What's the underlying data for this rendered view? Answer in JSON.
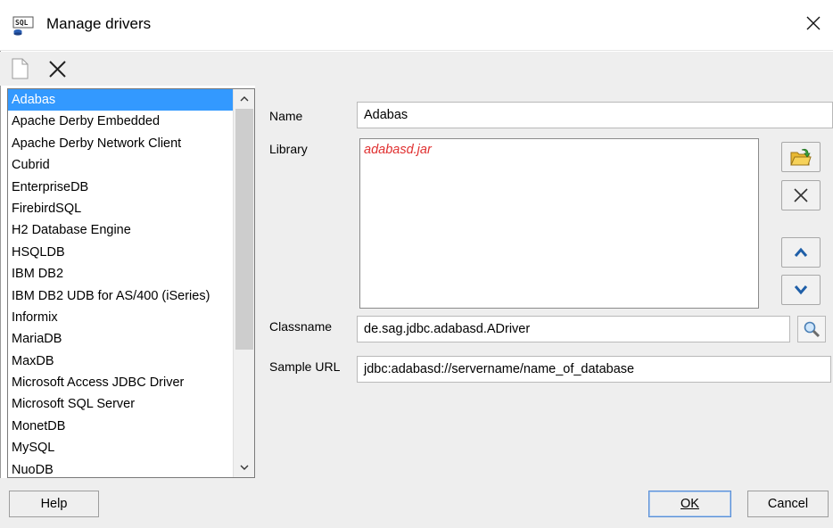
{
  "window": {
    "title": "Manage drivers",
    "app_icon": "sql-icon",
    "close_icon": "close-icon"
  },
  "toolbar": {
    "new_icon": "new-document-icon",
    "delete_icon": "delete-icon"
  },
  "drivers": [
    "Adabas",
    "Apache Derby Embedded",
    "Apache Derby Network Client",
    "Cubrid",
    "EnterpriseDB",
    "FirebirdSQL",
    "H2 Database Engine",
    "HSQLDB",
    "IBM DB2",
    "IBM DB2 UDB for AS/400 (iSeries)",
    "Informix",
    "MariaDB",
    "MaxDB",
    "Microsoft Access JDBC Driver",
    "Microsoft SQL Server",
    "MonetDB",
    "MySQL",
    "NuoDB"
  ],
  "selected_driver": "Adabas",
  "form": {
    "name_label": "Name",
    "name_value": "Adabas",
    "library_label": "Library",
    "library_entries": [
      "adabasd.jar"
    ],
    "classname_label": "Classname",
    "classname_value": "de.sag.jdbc.adabasd.ADriver",
    "sample_url_label": "Sample URL",
    "sample_url_value": "jdbc:adabasd://servername/name_of_database"
  },
  "footer": {
    "help_label": "Help",
    "ok_label": "OK",
    "cancel_label": "Cancel"
  },
  "colors": {
    "selection": "#3399ff",
    "missing_library": "#e03030",
    "arrow_blue": "#1f5fa8"
  }
}
